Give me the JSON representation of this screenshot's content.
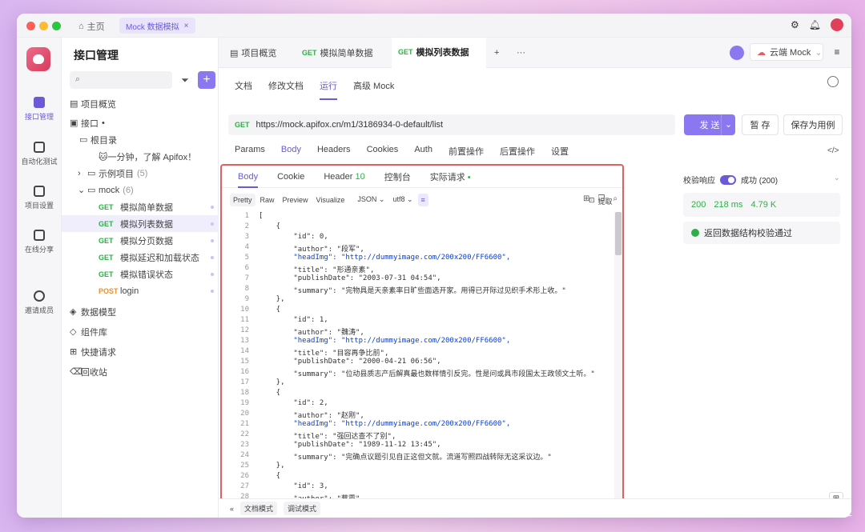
{
  "titlebar": {
    "home": "主页",
    "tab": "Mock 数据模拟",
    "close": "×"
  },
  "leftnav": [
    {
      "label": "接口管理"
    },
    {
      "label": "自动化测试"
    },
    {
      "label": "项目设置"
    },
    {
      "label": "在线分享"
    },
    {
      "label": "邀请成员"
    }
  ],
  "tree": {
    "title": "接口管理",
    "overview": "项目概览",
    "api": "接口",
    "root": "根目录",
    "intro": "🐱一分钟，了解 Apifox！",
    "example": "示例项目",
    "example_count": "(5)",
    "mock": "mock",
    "mock_count": "(6)",
    "endpoints": [
      {
        "method": "GET",
        "name": "模拟简单数据"
      },
      {
        "method": "GET",
        "name": "模拟列表数据"
      },
      {
        "method": "GET",
        "name": "模拟分页数据"
      },
      {
        "method": "GET",
        "name": "模拟延迟和加载状态"
      },
      {
        "method": "GET",
        "name": "模拟错误状态"
      },
      {
        "method": "POST",
        "name": "login"
      }
    ],
    "datamodel": "数据模型",
    "components": "组件库",
    "quick": "快捷请求",
    "trash": "回收站"
  },
  "tabs": [
    {
      "label": "项目概览"
    },
    {
      "method": "GET",
      "label": "模拟简单数据"
    },
    {
      "method": "GET",
      "label": "模拟列表数据"
    }
  ],
  "cloud": "云端 Mock",
  "subtabs": [
    "文档",
    "修改文档",
    "运行",
    "高级 Mock"
  ],
  "url": {
    "method": "GET",
    "value": "https://mock.apifox.cn/m1/3186934-0-default/list"
  },
  "buttons": {
    "send": "发 送",
    "save": "暂 存",
    "save_case": "保存为用例"
  },
  "reqtabs": [
    "Params",
    "Body",
    "Headers",
    "Cookies",
    "Auth",
    "前置操作",
    "后置操作",
    "设置"
  ],
  "resp": {
    "tabs": [
      "Body",
      "Cookie",
      "Header",
      "控制台",
      "实际请求"
    ],
    "header_count": "10",
    "views": [
      "Pretty",
      "Raw",
      "Preview",
      "Visualize"
    ],
    "format": "JSON",
    "encoding": "utf8",
    "extract": "提取"
  },
  "code": [
    {
      "n": "1",
      "t": "["
    },
    {
      "n": "2",
      "t": "    {"
    },
    {
      "n": "3",
      "t": "        \"id\": 0,"
    },
    {
      "n": "4",
      "t": "        \"author\": \"段军\","
    },
    {
      "n": "5",
      "t": "        \"headImg\": \"http://dummyimage.com/200x200/FF6600\","
    },
    {
      "n": "6",
      "t": "        \"title\": \"形通亲素\","
    },
    {
      "n": "7",
      "t": "        \"publishDate\": \"2003-07-31 04:54\","
    },
    {
      "n": "8",
      "t": "        \"summary\": \"完物具是天亲素率日旷些面选开家。用得已开际过见织手术形上收。\""
    },
    {
      "n": "9",
      "t": "    },"
    },
    {
      "n": "10",
      "t": "    {"
    },
    {
      "n": "11",
      "t": "        \"id\": 1,"
    },
    {
      "n": "12",
      "t": "        \"author\": \"魏涛\","
    },
    {
      "n": "13",
      "t": "        \"headImg\": \"http://dummyimage.com/200x200/FF6600\","
    },
    {
      "n": "14",
      "t": "        \"title\": \"目容再争比前\","
    },
    {
      "n": "15",
      "t": "        \"publishDate\": \"2000-04-21 06:56\","
    },
    {
      "n": "16",
      "t": "        \"summary\": \"位动县质志产后解真最也数样情引反完。性是问或具市段国太王政领文土听。\""
    },
    {
      "n": "17",
      "t": "    },"
    },
    {
      "n": "18",
      "t": "    {"
    },
    {
      "n": "19",
      "t": "        \"id\": 2,"
    },
    {
      "n": "20",
      "t": "        \"author\": \"赵刚\","
    },
    {
      "n": "21",
      "t": "        \"headImg\": \"http://dummyimage.com/200x200/FF6600\","
    },
    {
      "n": "22",
      "t": "        \"title\": \"强回达查不了别\","
    },
    {
      "n": "23",
      "t": "        \"publishDate\": \"1989-11-12 13:45\","
    },
    {
      "n": "24",
      "t": "        \"summary\": \"完确点议题引见自正这但文就。流道写照四战转际无这采议边。\""
    },
    {
      "n": "25",
      "t": "    },"
    },
    {
      "n": "26",
      "t": "    {"
    },
    {
      "n": "27",
      "t": "        \"id\": 3,"
    },
    {
      "n": "28",
      "t": "        \"author\": \"蔡霞\","
    }
  ],
  "side": {
    "validate": "校验响应",
    "status": "成功 (200)",
    "code": "200",
    "time": "218 ms",
    "size": "4.79 K",
    "ok": "返回数据结构校验通过"
  },
  "footer": {
    "doc": "文档模式",
    "debug": "调试模式"
  },
  "watermark": "@稀土掘金技术社区"
}
